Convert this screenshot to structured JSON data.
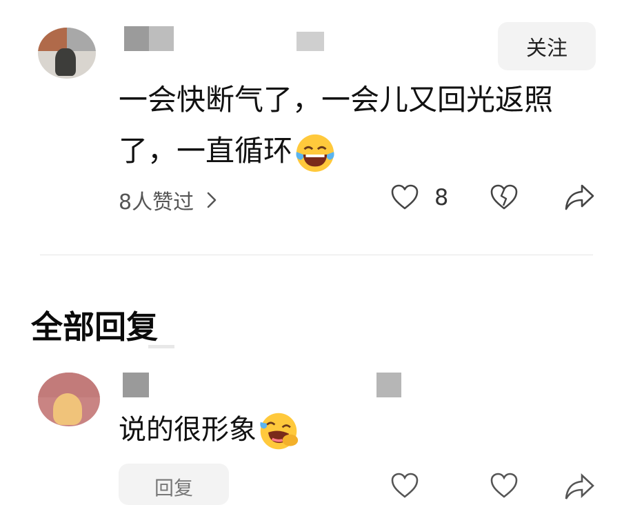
{
  "comment": {
    "follow_label": "关注",
    "text": "一会快断气了，一会儿又回光返照了，一直循环",
    "emoji_icon": "laughing-tears-emoji",
    "likers_label": "8人赞过",
    "like_count": "8"
  },
  "section": {
    "title": "全部回复"
  },
  "reply": {
    "text": "说的很形象",
    "emoji_icon": "rofl-emoji",
    "reply_button_label": "回复"
  },
  "colors": {
    "follow_bg": "#f3f3f3",
    "text": "#111111",
    "muted": "#555555",
    "emoji_yellow": "#ffc93c"
  }
}
